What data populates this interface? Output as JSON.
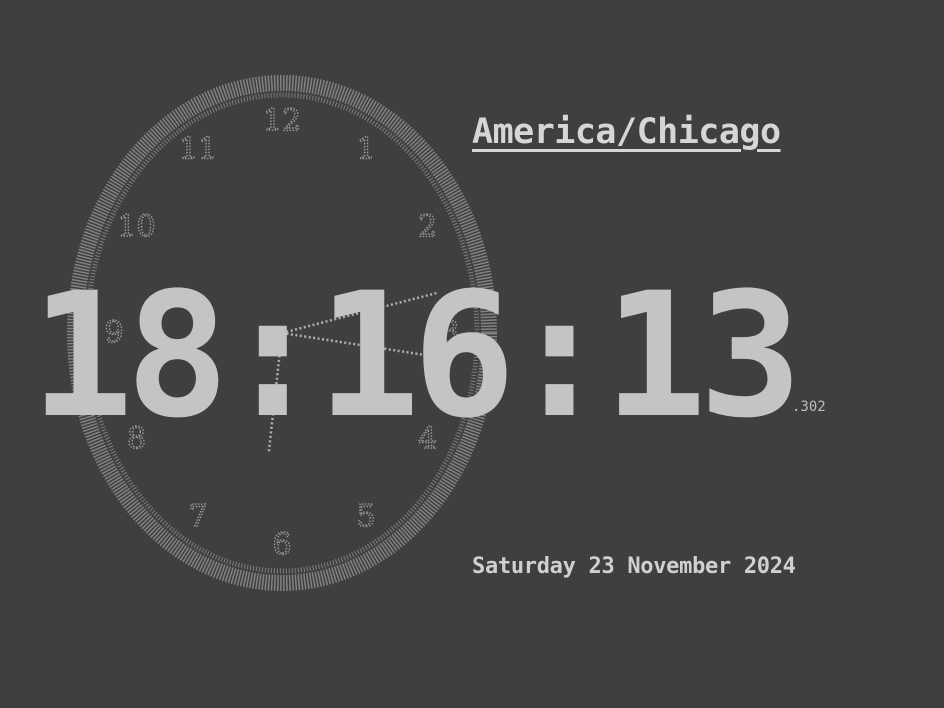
{
  "clock": {
    "timezone": "America/Chicago",
    "time": "18:16:13",
    "milliseconds": ".302",
    "date": "Saturday 23 November 2024",
    "dial_numbers": [
      "12",
      "1",
      "2",
      "3",
      "4",
      "5",
      "6",
      "7",
      "8",
      "9",
      "10",
      "11"
    ],
    "hands": {
      "hour": 18,
      "minute": 16,
      "second": 13
    }
  },
  "colors": {
    "background": "#3f3f3f",
    "text": "#c4c4c4",
    "dial": "#8e8e8e"
  }
}
